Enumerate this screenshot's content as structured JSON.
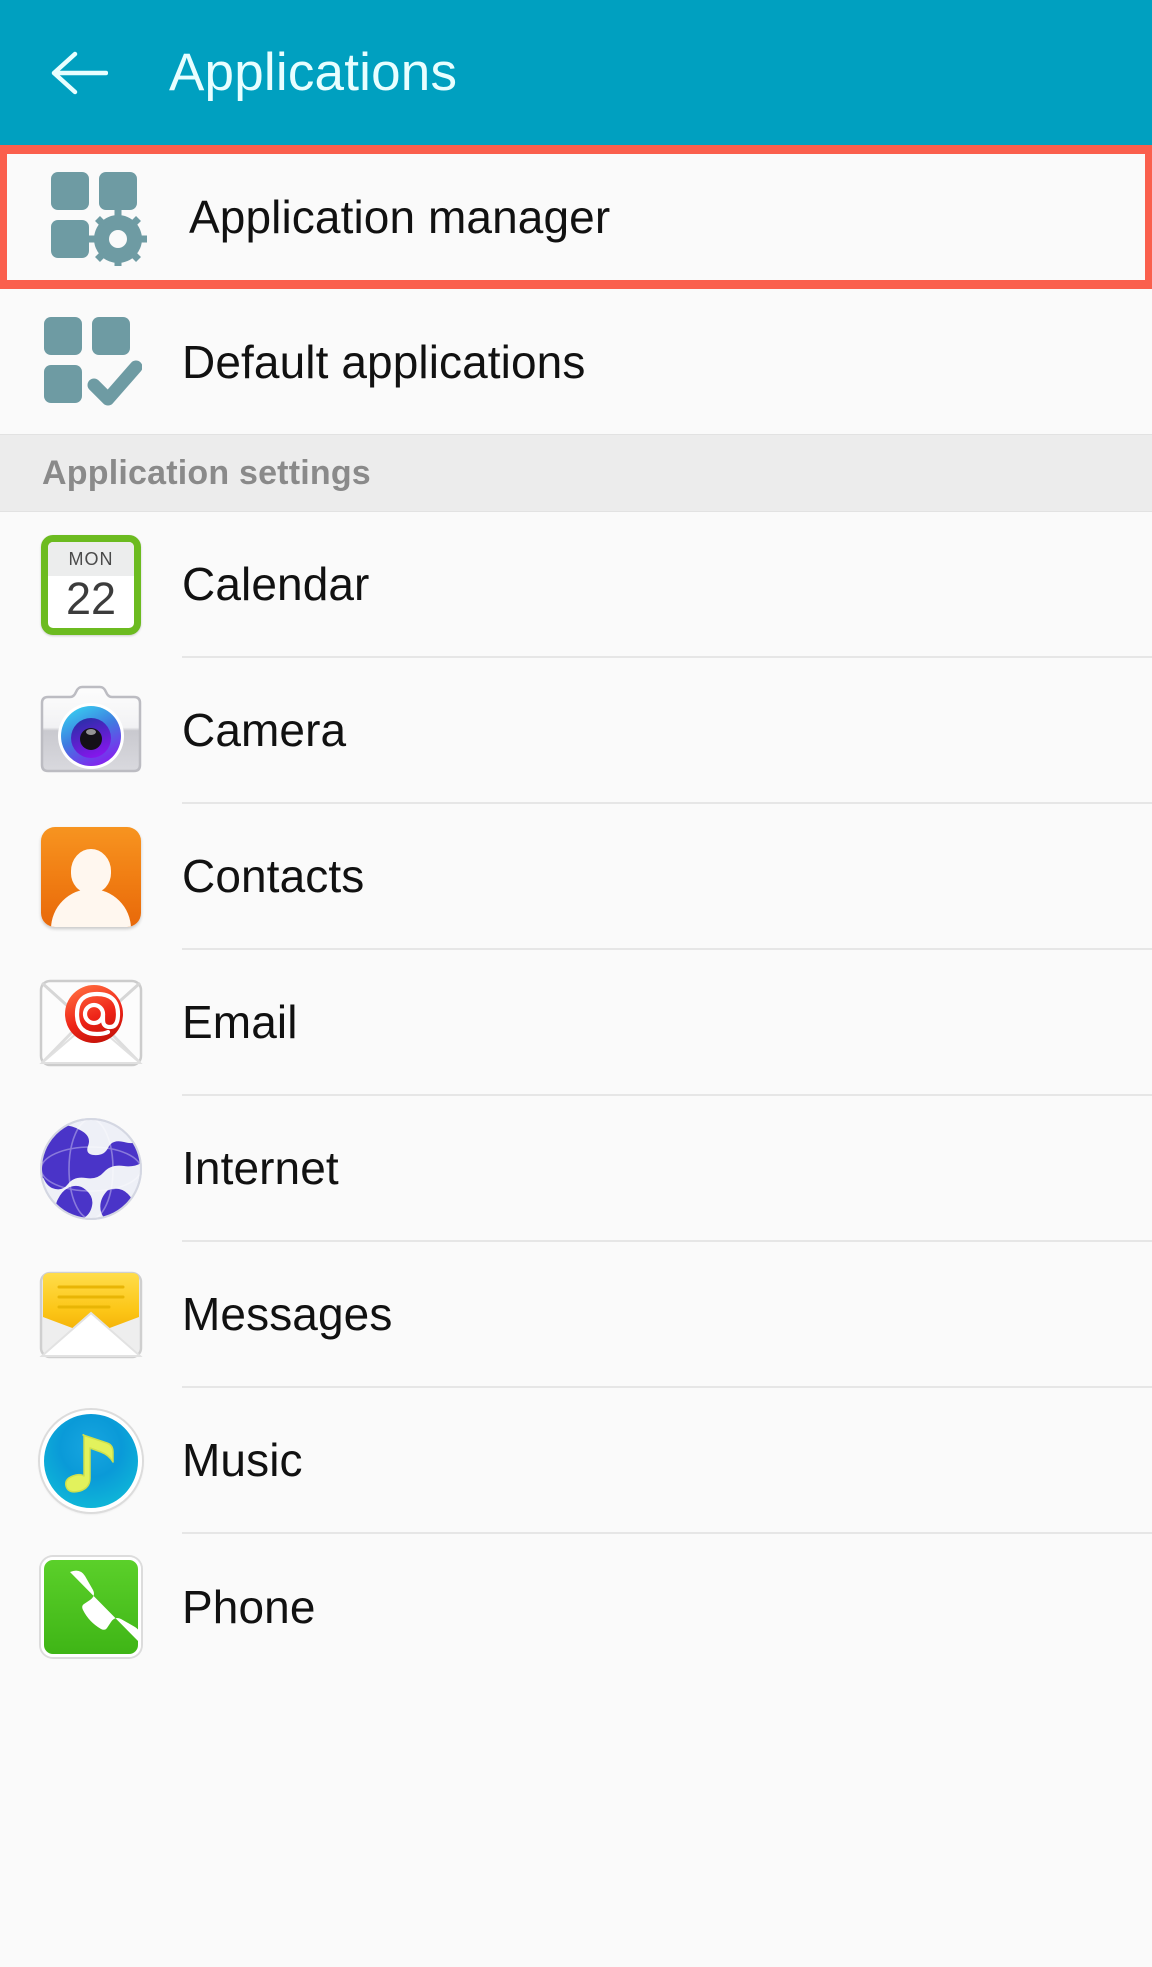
{
  "header": {
    "title": "Applications",
    "back_icon": "back-arrow-icon",
    "bg_color": "#00a0c0",
    "title_color": "#e8feff"
  },
  "highlight": {
    "color": "#fa5f4d",
    "target": "Application manager"
  },
  "top_items": [
    {
      "label": "Application manager",
      "icon": "apps-gear-icon",
      "highlighted": true
    },
    {
      "label": "Default applications",
      "icon": "apps-check-icon",
      "highlighted": false
    }
  ],
  "section": {
    "label": "Application settings",
    "bg_color": "#ececec",
    "text_color": "#8a8a8a"
  },
  "apps": [
    {
      "label": "Calendar",
      "icon": "calendar-icon",
      "calendar_dow": "MON",
      "calendar_day": "22",
      "accent": "#6cbb20"
    },
    {
      "label": "Camera",
      "icon": "camera-icon",
      "accent": "#7b2ff7"
    },
    {
      "label": "Contacts",
      "icon": "contacts-icon",
      "accent": "#f07c12"
    },
    {
      "label": "Email",
      "icon": "email-icon",
      "accent": "#e8291f"
    },
    {
      "label": "Internet",
      "icon": "internet-globe-icon",
      "accent": "#4433c8"
    },
    {
      "label": "Messages",
      "icon": "messages-icon",
      "accent": "#f4c21a"
    },
    {
      "label": "Music",
      "icon": "music-note-icon",
      "accent": "#0a9ad8"
    },
    {
      "label": "Phone",
      "icon": "phone-icon",
      "accent": "#3fb516"
    }
  ],
  "icon_tint": "#6e9ba3"
}
